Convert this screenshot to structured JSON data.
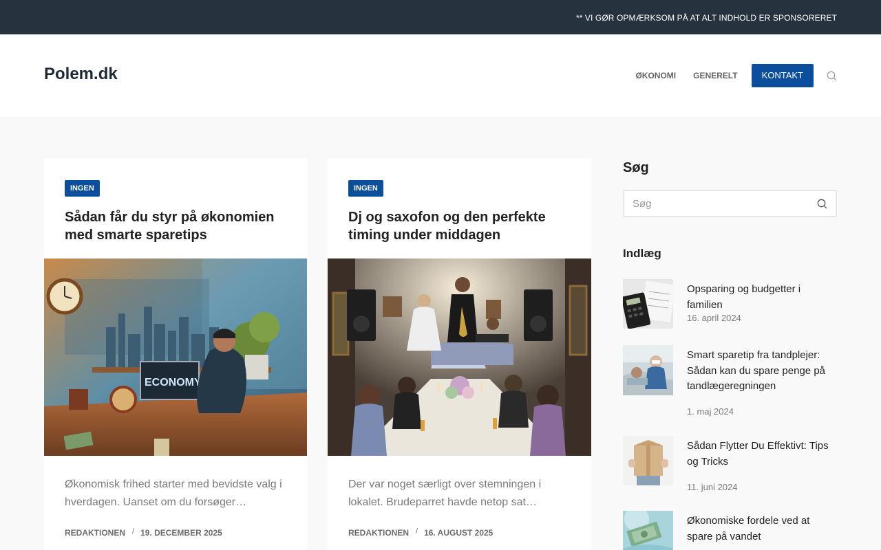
{
  "topbar": {
    "notice": "** VI GØR OPMÆRKSOM PÅ AT ALT INDHOLD ER SPONSORERET"
  },
  "header": {
    "logo": "Polem.dk",
    "nav": [
      {
        "label": "ØKONOMI"
      },
      {
        "label": "GENERELT"
      }
    ],
    "contact_label": "KONTAKT"
  },
  "articles": [
    {
      "category": "INGEN",
      "title": "Sådan får du styr på økonomien med smarte sparetips",
      "image_text": "ECONOMY",
      "excerpt": "Økonomisk frihed starter med bevidste valg i hverdagen. Uanset om du forsøger…",
      "author": "REDAKTIONEN",
      "separator": "/",
      "date": "19. DECEMBER 2025"
    },
    {
      "category": "INGEN",
      "title": "Dj og saxofon og den perfekte timing under middagen",
      "excerpt": "Der var noget særligt over stemningen i lokalet. Brudeparret havde netop sat…",
      "author": "REDAKTIONEN",
      "separator": "/",
      "date": "16. AUGUST 2025"
    }
  ],
  "sidebar": {
    "search_heading": "Søg",
    "search_placeholder": "Søg",
    "posts_heading": "Indlæg",
    "posts": [
      {
        "title": "Opsparing og budgetter i familien",
        "date": "16. april 2024"
      },
      {
        "title": "Smart sparetip fra tandplejer: Sådan kan du spare penge på tandlægeregningen",
        "date": "1. maj 2024"
      },
      {
        "title": "Sådan Flytter Du Effektivt: Tips og Tricks",
        "date": "11. juni 2024"
      },
      {
        "title": "Økonomiske fordele ved at spare på vandet",
        "date": ""
      }
    ]
  },
  "colors": {
    "topbar": "#27323f",
    "accent": "#0b4f9c",
    "background": "#f9f9fa"
  },
  "icons": {
    "search": "search-icon"
  }
}
